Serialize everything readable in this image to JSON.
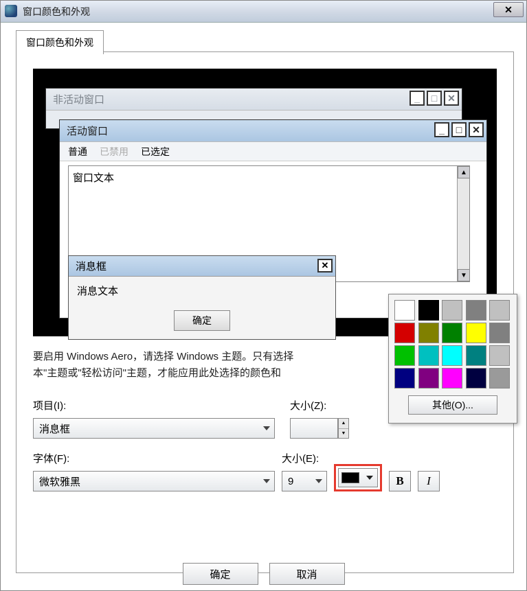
{
  "window_title": "窗口颜色和外观",
  "tab_label": "窗口颜色和外观",
  "preview": {
    "inactive_title": "非活动窗口",
    "active_title": "活动窗口",
    "menu_normal": "普通",
    "menu_disabled": "已禁用",
    "menu_selected": "已选定",
    "window_text": "窗口文本",
    "msgbox_title": "消息框",
    "msgbox_text": "消息文本",
    "msgbox_ok": "确定"
  },
  "description_line1": "要启用 Windows Aero，请选择 Windows 主题。只有选择",
  "description_line2": "本\"主题或\"轻松访问\"主题，才能应用此处选择的颜色和",
  "labels": {
    "item": "项目(I):",
    "size1": "大小(Z):",
    "font": "字体(F):",
    "size2": "大小(E):"
  },
  "fields": {
    "item_value": "消息框",
    "size1_value": "",
    "font_value": "微软雅黑",
    "size2_value": "9",
    "color_value": "#000000"
  },
  "color_palette": [
    "#ffffff",
    "#000000",
    "#c0c0c0",
    "#808080",
    "#c0c0c0",
    "#d40000",
    "#808000",
    "#008000",
    "#ffff00",
    "#808080",
    "#00c000",
    "#00c0c0",
    "#00ffff",
    "#008080",
    "#c0c0c0",
    "#000080",
    "#800080",
    "#ff00ff",
    "#000040",
    "#9a9a9a"
  ],
  "selected_swatch_index": 1,
  "other_colors_label": "其他(O)...",
  "bold_label": "B",
  "italic_label": "I",
  "buttons": {
    "ok": "确定",
    "cancel": "取消"
  }
}
